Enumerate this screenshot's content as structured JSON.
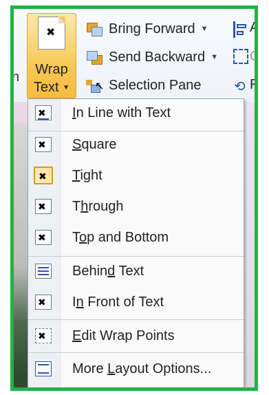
{
  "ribbon": {
    "edge_text": "n",
    "wrap_text": {
      "line1": "Wrap",
      "line2": "Text"
    },
    "bring_forward": "Bring Forward",
    "send_backward": "Send Backward",
    "selection_pane": "Selection Pane",
    "cut_align": "A",
    "cut_group": "G",
    "cut_rotate": "R"
  },
  "menu": {
    "items": [
      {
        "pre": "",
        "u": "I",
        "post": "n Line with Text"
      },
      {
        "pre": "",
        "u": "S",
        "post": "quare"
      },
      {
        "pre": "",
        "u": "T",
        "post": "ight"
      },
      {
        "pre": "T",
        "u": "h",
        "post": "rough"
      },
      {
        "pre": "T",
        "u": "o",
        "post": "p and Bottom"
      },
      {
        "pre": "Behin",
        "u": "d",
        "post": " Text"
      },
      {
        "pre": "I",
        "u": "n",
        "post": " Front of Text"
      },
      {
        "pre": "",
        "u": "E",
        "post": "dit Wrap Points"
      },
      {
        "pre": "More ",
        "u": "L",
        "post": "ayout Options..."
      }
    ],
    "selected": "Tight"
  },
  "colors": {
    "frame": "#1fb247",
    "highlight": "#f8c955"
  }
}
